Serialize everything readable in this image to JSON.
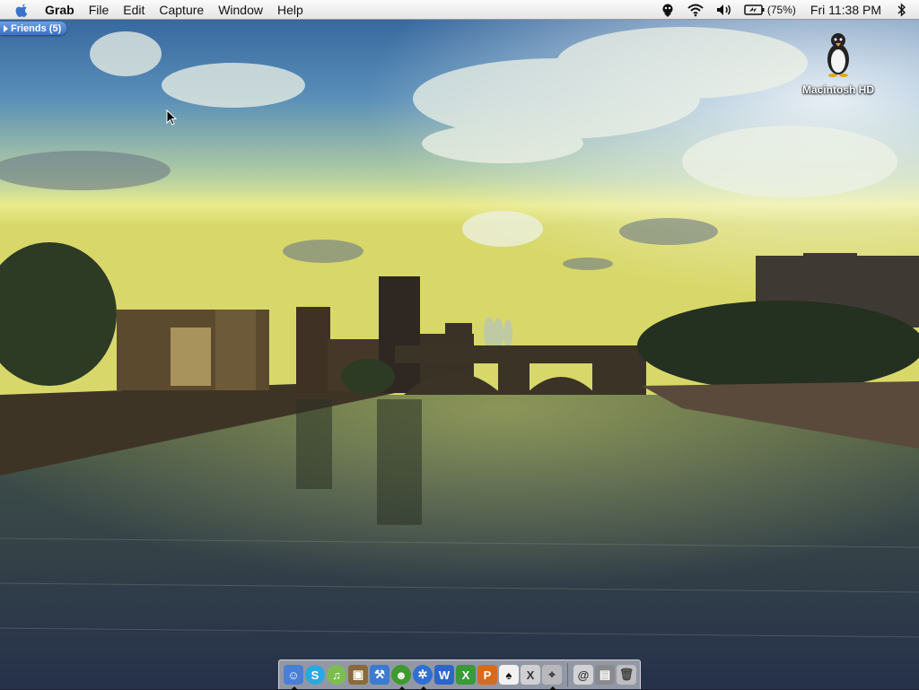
{
  "menubar": {
    "apple_icon": "apple-logo-icon",
    "app_name": "Grab",
    "menus": [
      "File",
      "Edit",
      "Capture",
      "Window",
      "Help"
    ],
    "status": {
      "chat_icon": "ichat-status-icon",
      "wifi_icon": "airport-wifi-icon",
      "volume_icon": "volume-icon",
      "battery_icon": "battery-charging-icon",
      "battery_text": "(75%)",
      "clock": "Fri 11:38 PM",
      "bluetooth_icon": "bluetooth-icon"
    }
  },
  "friends_drawer": {
    "label": "Friends (5)"
  },
  "desktop": {
    "wallpaper": "river-castle-sunset",
    "icons": [
      {
        "label": "Macintosh HD",
        "icon": "penguin-drive-icon"
      }
    ]
  },
  "dock": {
    "apps": [
      {
        "name": "Finder",
        "icon": "finder-icon",
        "running": true,
        "color": "#4a7fd6"
      },
      {
        "name": "Skype",
        "icon": "skype-icon",
        "running": false,
        "color": "#2aa8e0"
      },
      {
        "name": "iTunes",
        "icon": "itunes-icon",
        "running": false,
        "color": "#7dbd4f"
      },
      {
        "name": "iPhoto",
        "icon": "iphoto-icon",
        "running": false,
        "color": "#8a6a3a"
      },
      {
        "name": "Xcode",
        "icon": "xcode-icon",
        "running": false,
        "color": "#3d7bd0"
      },
      {
        "name": "Adium",
        "icon": "adium-icon",
        "running": true,
        "color": "#3f9a2e"
      },
      {
        "name": "Safari",
        "icon": "safari-icon",
        "running": true,
        "color": "#2f6fd1"
      },
      {
        "name": "Word",
        "icon": "word-icon",
        "running": false,
        "color": "#2e66c8"
      },
      {
        "name": "Excel",
        "icon": "excel-icon",
        "running": false,
        "color": "#3a9a3a"
      },
      {
        "name": "PowerPoint",
        "icon": "powerpoint-icon",
        "running": false,
        "color": "#d86a1c"
      },
      {
        "name": "Solitaire",
        "icon": "cards-icon",
        "running": false,
        "color": "#f2f2f2"
      },
      {
        "name": "Mac OS X",
        "icon": "macosx-icon",
        "running": false,
        "color": "#cfcfd4"
      },
      {
        "name": "Grab",
        "icon": "grab-icon",
        "running": true,
        "color": "#b8b8bc"
      }
    ],
    "docs": [
      {
        "name": "Mail",
        "icon": "mail-stamp-icon",
        "color": "#d2d2d6"
      },
      {
        "name": "Pictures",
        "icon": "pictures-folder-icon",
        "color": "#8a8a8e"
      },
      {
        "name": "Trash",
        "icon": "trash-icon",
        "color": "#bdbdc2"
      }
    ]
  }
}
